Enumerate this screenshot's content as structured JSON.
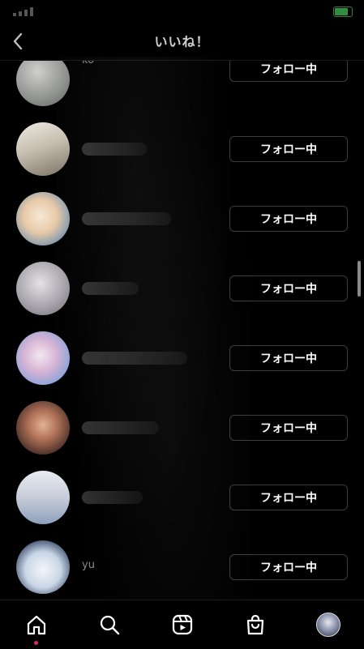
{
  "header": {
    "title": "いいね！",
    "back_icon": "chevron-left-icon"
  },
  "likes": [
    {
      "username": "ko",
      "button": "フォロー中",
      "avatar_colors": [
        "#b9b9b6",
        "#7d7f7c"
      ]
    },
    {
      "username": "",
      "button": "フォロー中",
      "avatar_colors": [
        "#e6e1d8",
        "#8e8577"
      ]
    },
    {
      "username": "",
      "button": "フォロー中",
      "avatar_colors": [
        "#f1e3cf",
        "#6e8fa8"
      ]
    },
    {
      "username": "",
      "button": "フォロー中",
      "avatar_colors": [
        "#d4d2d6",
        "#8f8c95"
      ]
    },
    {
      "username": "",
      "button": "フォロー中",
      "avatar_colors": [
        "#e9d3e6",
        "#8aa4d8"
      ]
    },
    {
      "username": "",
      "button": "フォロー中",
      "avatar_colors": [
        "#d39a7b",
        "#3b2a26"
      ]
    },
    {
      "username": "",
      "button": "フォロー中",
      "avatar_colors": [
        "#dfe1e8",
        "#9aa7c0"
      ]
    },
    {
      "username": "yu",
      "button": "フォロー中",
      "avatar_colors": [
        "#eef3f8",
        "#2a3a5a"
      ]
    }
  ],
  "tab_bar": {
    "items": [
      {
        "icon": "home-icon",
        "active": true
      },
      {
        "icon": "search-icon",
        "active": false
      },
      {
        "icon": "reels-icon",
        "active": false
      },
      {
        "icon": "shop-icon",
        "active": false
      },
      {
        "icon": "profile-avatar",
        "active": false
      }
    ],
    "notification_dot_color": "#e0245e"
  },
  "colors": {
    "background": "#000000",
    "button_border": "#3c3c3c",
    "text": "#ffffff",
    "muted": "#8a8a8a"
  }
}
